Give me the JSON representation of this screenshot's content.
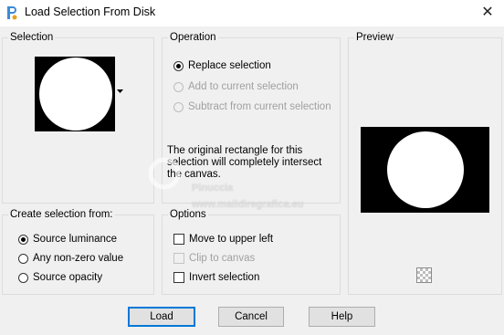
{
  "window": {
    "title": "Load Selection From Disk",
    "close_glyph": "✕"
  },
  "selection": {
    "group_label": "Selection"
  },
  "operation": {
    "group_label": "Operation",
    "options": [
      {
        "label": "Replace selection",
        "checked": true,
        "enabled": true
      },
      {
        "label": "Add to current selection",
        "checked": false,
        "enabled": false
      },
      {
        "label": "Subtract from current selection",
        "checked": false,
        "enabled": false
      }
    ],
    "note_lines": [
      "The original rectangle for this",
      "selection will completely intersect",
      "the canvas."
    ]
  },
  "preview": {
    "group_label": "Preview"
  },
  "create_from": {
    "group_label": "Create selection from:",
    "options": [
      {
        "label": "Source luminance",
        "checked": true
      },
      {
        "label": "Any non-zero value",
        "checked": false
      },
      {
        "label": "Source opacity",
        "checked": false
      }
    ]
  },
  "options": {
    "group_label": "Options",
    "items": [
      {
        "label": "Move to upper left",
        "checked": false,
        "enabled": true
      },
      {
        "label": "Clip to canvas",
        "checked": false,
        "enabled": false
      },
      {
        "label": "Invert selection",
        "checked": false,
        "enabled": true
      }
    ]
  },
  "buttons": {
    "load": "Load",
    "cancel": "Cancel",
    "help": "Help"
  },
  "watermark": {
    "line1": "Pinuccia",
    "line2": "www.maildiregrafica.eu"
  }
}
